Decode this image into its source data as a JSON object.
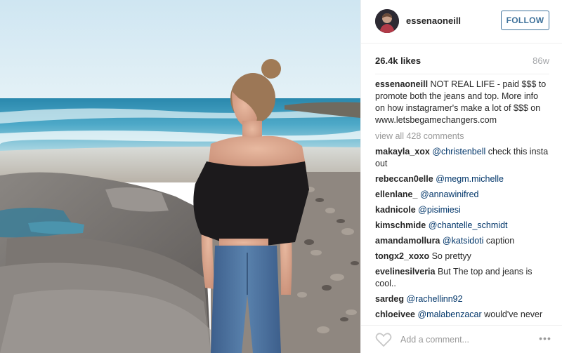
{
  "post": {
    "username": "essenaoneill",
    "follow_label": "FOLLOW",
    "likes": "26.4k likes",
    "timestamp": "86w",
    "caption": {
      "username": "essenaoneill",
      "text": "NOT REAL LIFE - paid $$$ to promote both the jeans and top. More info on how instagramer's make a lot of $$$ on www.letsbegamechangers.com"
    },
    "view_all": "view all 428 comments",
    "comments": [
      {
        "username": "makayla_xox",
        "mention": "@christenbell",
        "text": "check this insta out"
      },
      {
        "username": "rebeccan0elle",
        "mention": "@megm.michelle",
        "text": ""
      },
      {
        "username": "ellenlane_",
        "mention": "@annawinifred",
        "text": ""
      },
      {
        "username": "kadnicole",
        "mention": "@pisimiesi",
        "text": ""
      },
      {
        "username": "kimschmide",
        "mention": "@chantelle_schmidt",
        "text": ""
      },
      {
        "username": "amandamollura",
        "mention": "@katsidoti",
        "text": "caption"
      },
      {
        "username": "tongx2_xoxo",
        "mention": "",
        "text": "So prettyy"
      },
      {
        "username": "evelinesilveria",
        "mention": "",
        "text": "But The top and jeans is cool.."
      },
      {
        "username": "sardeg",
        "mention": "@rachellinn92",
        "text": ""
      },
      {
        "username": "chloeivee",
        "mention": "@malabenzacar",
        "text": "would've never thought that she was paid"
      }
    ],
    "add_comment_placeholder": "Add a comment...",
    "more_label": "•••"
  },
  "photo": {
    "description_icon": "beach-photo",
    "colors": {
      "sky": "#d9ecf5",
      "sea": "#3f9dbf",
      "rocks": "#6d6866",
      "top": "#1c1a1c",
      "jeans": "#4a6d9a",
      "skin": "#d9a78f"
    }
  },
  "colors": {
    "accent": "#3f729b",
    "link": "#003569",
    "muted": "#999999",
    "text": "#262626"
  },
  "icons": {
    "heart": "heart-icon",
    "more": "more-options-icon"
  }
}
